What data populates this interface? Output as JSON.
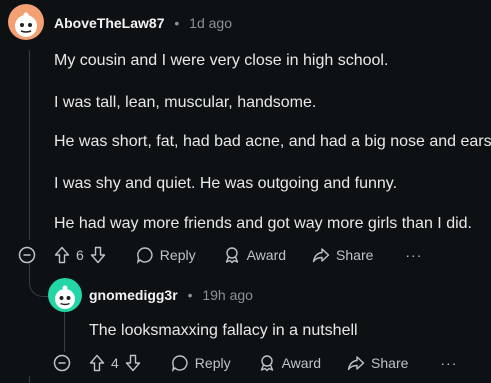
{
  "comment": {
    "username": "AboveTheLaw87",
    "separator": "•",
    "time": "1d ago",
    "paragraphs": [
      "My cousin and I were very close in high school.",
      "I was tall, lean, muscular, handsome.",
      "He was short, fat, had bad acne, and had a big nose and ears.",
      "I was shy and quiet. He was outgoing and funny.",
      "He had way more friends and got way more girls than I did."
    ],
    "votes": "6",
    "actions": {
      "reply": "Reply",
      "award": "Award",
      "share": "Share",
      "more": "···"
    }
  },
  "reply": {
    "username": "gnomedigg3r",
    "separator": "•",
    "time": "19h ago",
    "text": "The looksmaxxing fallacy in a nutshell",
    "votes": "4",
    "actions": {
      "reply": "Reply",
      "award": "Award",
      "share": "Share",
      "more": "···"
    }
  },
  "colors": {
    "background": "#0e1113",
    "avatar1": "#f2a074",
    "avatar2": "#23d6a6"
  },
  "icons": [
    "collapse-icon",
    "upvote-icon",
    "downvote-icon",
    "reply-icon",
    "award-icon",
    "share-icon",
    "more-icon"
  ]
}
